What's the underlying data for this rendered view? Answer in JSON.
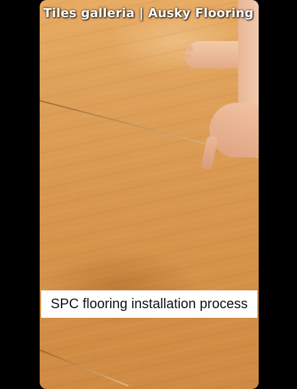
{
  "video": {
    "watermark": "Tiles galleria | Ausky Flooring",
    "caption": "SPC flooring installation process"
  }
}
